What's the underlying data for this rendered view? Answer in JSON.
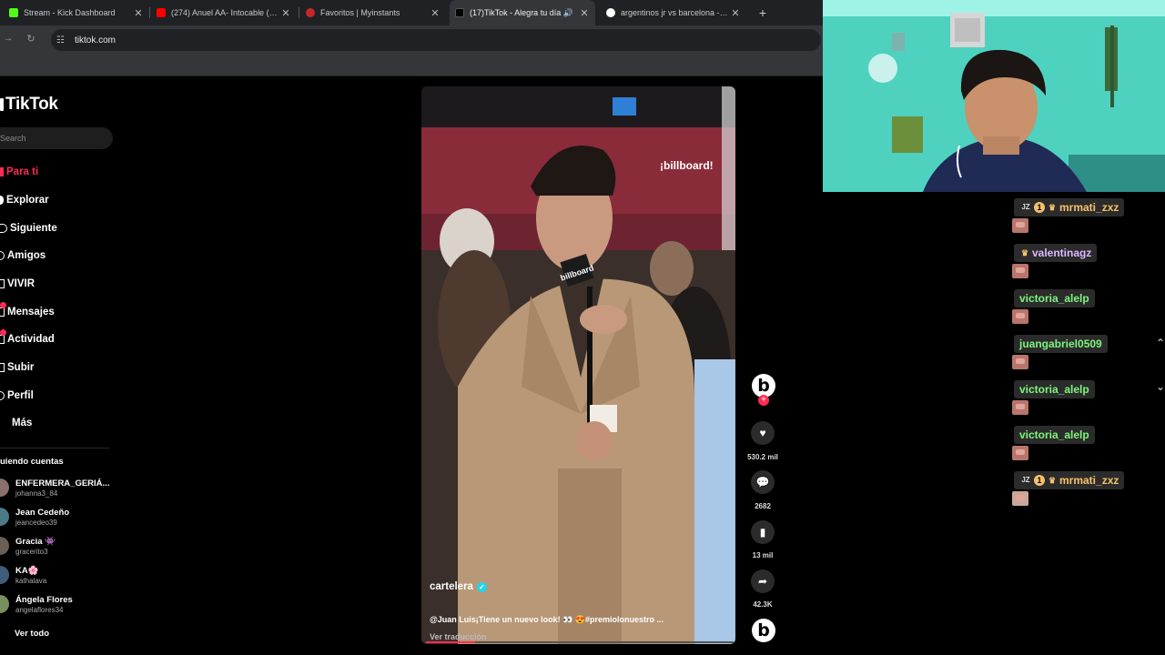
{
  "browser": {
    "tabs": [
      {
        "title": "Stream - Kick Dashboard",
        "favicon_color": "#53fc18",
        "active": false
      },
      {
        "title": "(274) Anuel AA- Intocable (Tira",
        "favicon_color": "#ff0000",
        "active": false
      },
      {
        "title": "Favoritos | Myinstants",
        "favicon_color": "#c62828",
        "active": false
      },
      {
        "title": "(17)TikTok - Alegra tu día",
        "favicon_color": "#000000",
        "active": true
      },
      {
        "title": "argentinos jr vs barcelona - Bu",
        "favicon_color": "#4285f4",
        "active": false
      }
    ],
    "url": "tiktok.com"
  },
  "tiktok": {
    "logo": "TikTok",
    "search_placeholder": "Search",
    "nav": [
      {
        "label": "Para ti",
        "active": true
      },
      {
        "label": "Explorar",
        "active": false
      },
      {
        "label": "Siguiente",
        "active": false
      },
      {
        "label": "Amigos",
        "active": false
      },
      {
        "label": "VIVIR",
        "active": false
      },
      {
        "label": "Mensajes",
        "active": false
      },
      {
        "label": "Actividad",
        "active": false
      },
      {
        "label": "Subir",
        "active": false
      },
      {
        "label": "Perfil",
        "active": false
      },
      {
        "label": "Más",
        "active": false
      }
    ],
    "following_title": "uiendo cuentas",
    "accounts": [
      {
        "name": "ENFERMERA_GERIÁ...",
        "handle": "johanna3_84"
      },
      {
        "name": "Jean Cedeño",
        "handle": "jeancedeo39"
      },
      {
        "name": "Gracia 👾",
        "handle": "gracerito3"
      },
      {
        "name": "KA🌸",
        "handle": "kathalava"
      },
      {
        "name": "Ángela Flores",
        "handle": "angelaflores34"
      }
    ],
    "see_all": "Ver todo",
    "video": {
      "overlay_brand": "¡billboard!",
      "mic_brand": "billboard",
      "author": "cartelera",
      "caption": "@Juan Luis¡Tiene un nuevo look! 👀 😍#premiolonuestro ...",
      "translate": "Ver traducción",
      "progress": 0.16
    },
    "actions": {
      "avatar_letter": "b",
      "likes": "530.2 mil",
      "comments": "2682",
      "saves": "13 mil",
      "shares": "42.3K"
    }
  },
  "chat": {
    "messages": [
      {
        "user": "mrmati_zxz",
        "color": "#f5c26b",
        "badges": [
          "JZ",
          "1",
          "👑"
        ]
      },
      {
        "user": "valentinagz",
        "color": "#d9b8ff",
        "badges": [
          "👑"
        ]
      },
      {
        "user": "victoria_alelp",
        "color": "#7df57d",
        "badges": []
      },
      {
        "user": "juangabriel0509",
        "color": "#7df57d",
        "badges": []
      },
      {
        "user": "victoria_alelp",
        "color": "#7df57d",
        "badges": []
      },
      {
        "user": "victoria_alelp",
        "color": "#7df57d",
        "badges": []
      },
      {
        "user": "mrmati_zxz",
        "color": "#f5c26b",
        "badges": [
          "JZ",
          "1",
          "👑"
        ]
      }
    ]
  }
}
